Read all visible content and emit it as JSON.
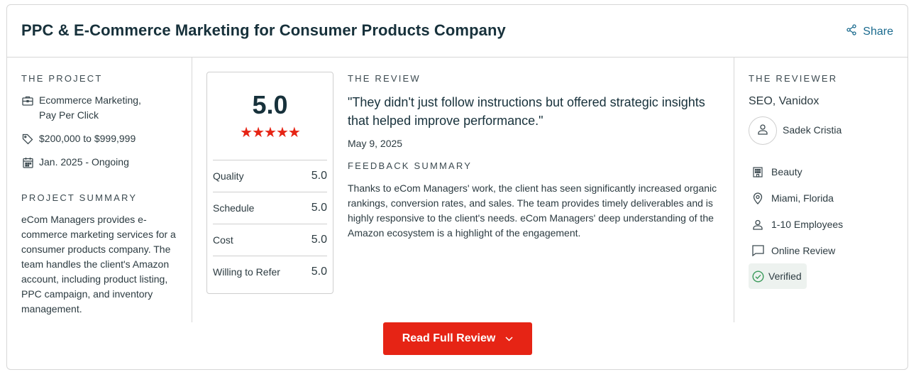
{
  "header": {
    "title": "PPC & E-Commerce Marketing for Consumer Products Company",
    "share_label": "Share"
  },
  "project": {
    "section_label": "THE PROJECT",
    "services_line1": "Ecommerce Marketing,",
    "services_line2": "Pay Per Click",
    "budget": "$200,000 to $999,999",
    "timeline": "Jan. 2025 - Ongoing",
    "summary_label": "PROJECT SUMMARY",
    "summary": "eCom Managers provides e-commerce marketing services for a consumer products company. The team handles the client's Amazon account, including product listing, PPC campaign, and inventory management."
  },
  "rating": {
    "overall": "5.0",
    "stars": "★★★★★",
    "stars_value": 5,
    "rows": [
      {
        "label": "Quality",
        "value": "5.0"
      },
      {
        "label": "Schedule",
        "value": "5.0"
      },
      {
        "label": "Cost",
        "value": "5.0"
      },
      {
        "label": "Willing to Refer",
        "value": "5.0"
      }
    ]
  },
  "review": {
    "section_label": "THE REVIEW",
    "quote": "\"They didn't just follow instructions but offered strategic insights that helped improve performance.\"",
    "date": "May 9, 2025",
    "feedback_label": "FEEDBACK SUMMARY",
    "feedback": "Thanks to eCom Managers' work, the client has seen significantly increased organic rankings, conversion rates, and sales. The team provides timely deliverables and is highly responsive to the client's needs. eCom Managers' deep understanding of the Amazon ecosystem is a highlight of the engagement."
  },
  "reviewer": {
    "section_label": "THE REVIEWER",
    "title": "SEO, Vanidox",
    "name": "Sadek Cristia",
    "industry": "Beauty",
    "location": "Miami, Florida",
    "size": "1-10 Employees",
    "review_type": "Online Review",
    "verified": "Verified"
  },
  "actions": {
    "read_full_review": "Read Full Review"
  },
  "colors": {
    "accent_red": "#e62415",
    "share_blue": "#1a6a8e",
    "verified_green": "#3a9a5a"
  },
  "icons": [
    "share-icon",
    "briefcase-icon",
    "tag-icon",
    "calendar-icon",
    "star-icon",
    "user-icon",
    "building-icon",
    "location-pin-icon",
    "person-icon",
    "chat-bubble-icon",
    "check-circle-icon",
    "chevron-down-icon"
  ]
}
